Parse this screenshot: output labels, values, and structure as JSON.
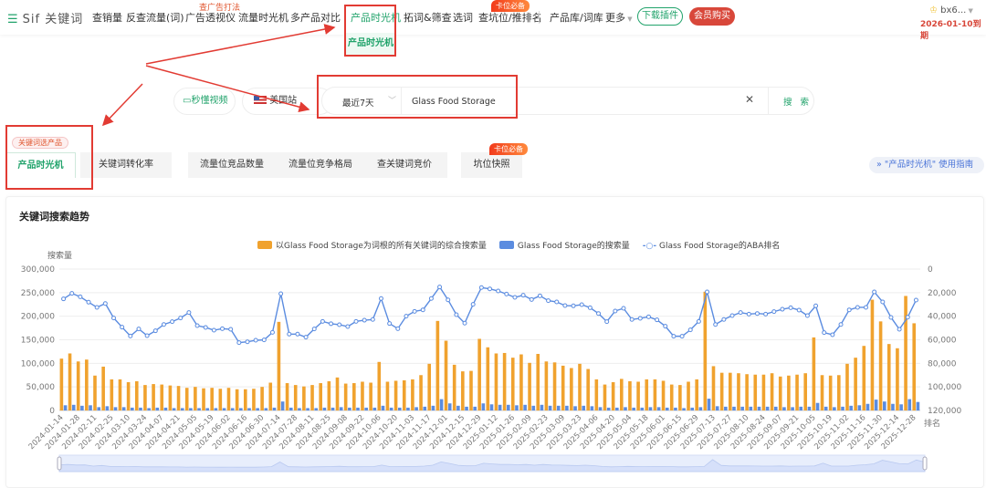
{
  "nav": {
    "logo": "Sif 关键词",
    "items": [
      "查销量",
      "反查流量(词)",
      "广告透视仪",
      "流量时光机",
      "多产品对比",
      "产品时光机",
      "拓词&筛查",
      "选词",
      "查坑位/推排名",
      "产品库/词库",
      "更多"
    ],
    "hint_ads": "查广告打法",
    "hint_rank": "卡位必备",
    "download": "下载插件",
    "vip": "会员购买",
    "user": "bx6...",
    "expire": "2026-01-10到期",
    "dropdown_item": "产品时光机"
  },
  "search": {
    "video": "秒懂视频",
    "site": "美国站",
    "range": "最近7天",
    "query": "Glass Food Storage",
    "button": "搜 索"
  },
  "tabs": {
    "badge": "关键词选产品",
    "items": [
      "产品时光机",
      "关键词转化率",
      "流量位竞品数量",
      "流量位竞争格局",
      "查关键词竞价",
      "坑位快照"
    ],
    "fire_badge": "卡位必备",
    "guide": "\"产品时光机\" 使用指南"
  },
  "colors": {
    "green": "#21a36b",
    "orange": "#f0a22e",
    "blue": "#5b8ce0",
    "red": "#e23b33"
  },
  "chart_data": {
    "type": "bar",
    "title": "关键词搜索趋势",
    "ylabel": "搜索量",
    "y2label": "排名",
    "ylim": [
      0,
      300000
    ],
    "y2lim": [
      0,
      120000
    ],
    "y2_inverted": true,
    "yticks": [
      "0",
      "50,000",
      "100,000",
      "150,000",
      "200,000",
      "250,000",
      "300,000"
    ],
    "y2ticks": [
      "0",
      "20,000",
      "40,000",
      "60,000",
      "80,000",
      "100,000",
      "120,000"
    ],
    "xtick_labels": [
      "2024-01-14",
      "2024-01-28",
      "2024-02-11",
      "2024-02-25",
      "2024-03-10",
      "2024-03-24",
      "2024-04-07",
      "2024-04-21",
      "2024-05-05",
      "2024-05-19",
      "2024-06-02",
      "2024-06-16",
      "2024-06-30",
      "2024-07-14",
      "2024-07-28",
      "2024-08-11",
      "2024-08-25",
      "2024-09-08",
      "2024-09-22",
      "2024-10-06",
      "2024-10-20",
      "2024-11-03",
      "2024-11-17",
      "2024-12-01",
      "2024-12-15",
      "2024-12-29",
      "2025-01-12",
      "2025-01-26",
      "2025-02-09",
      "2025-02-23",
      "2025-03-09",
      "2025-03-23",
      "2025-04-06",
      "2025-04-20",
      "2025-05-04",
      "2025-05-18",
      "2025-06-01",
      "2025-06-15",
      "2025-06-29",
      "2025-07-13",
      "2025-07-27",
      "2025-08-10",
      "2025-08-24",
      "2025-09-07",
      "2025-09-21",
      "2025-10-05",
      "2025-10-19",
      "2025-11-02",
      "2025-11-16",
      "2025-11-30",
      "2025-12-14",
      "2025-12-28"
    ],
    "series": [
      {
        "name": "以Glass Food Storage为词根的所有关键词的综合搜索量",
        "kind": "bar",
        "values": [
          110000,
          121000,
          104000,
          108000,
          74000,
          93000,
          66000,
          66000,
          60000,
          62000,
          54000,
          56000,
          55000,
          53000,
          52000,
          48000,
          50000,
          47000,
          48000,
          46000,
          48000,
          45000,
          45000,
          46000,
          50000,
          59000,
          188000,
          58000,
          54000,
          51000,
          54000,
          58000,
          62000,
          70000,
          57000,
          58000,
          61000,
          59000,
          103000,
          61000,
          63000,
          64000,
          66000,
          75000,
          99000,
          190000,
          148000,
          97000,
          83000,
          84000,
          152000,
          134000,
          121000,
          122000,
          112000,
          119000,
          101000,
          120000,
          104000,
          102000,
          95000,
          90000,
          99000,
          88000,
          66000,
          55000,
          60000,
          67000,
          62000,
          61000,
          66000,
          66000,
          63000,
          55000,
          54000,
          61000,
          66000,
          252000,
          94000,
          80000,
          80000,
          79000,
          77000,
          76000,
          76000,
          79000,
          72000,
          74000,
          76000,
          79000,
          155000,
          75000,
          74000,
          75000,
          99000,
          112000,
          137000,
          235000,
          189000,
          141000,
          132000,
          243000,
          185000
        ]
      },
      {
        "name": "Glass Food Storage的搜索量",
        "kind": "bar",
        "values": [
          11000,
          12000,
          10000,
          11000,
          7000,
          9000,
          7000,
          7000,
          6000,
          6000,
          5000,
          6000,
          6000,
          5000,
          5000,
          5000,
          5000,
          5000,
          5000,
          5000,
          5000,
          5000,
          5000,
          5000,
          5000,
          6000,
          19000,
          6000,
          5000,
          5000,
          5000,
          6000,
          6000,
          7000,
          6000,
          6000,
          6000,
          6000,
          10000,
          6000,
          6000,
          6000,
          7000,
          8000,
          10000,
          24000,
          15000,
          10000,
          8000,
          8000,
          15000,
          13000,
          12000,
          12000,
          11000,
          12000,
          10000,
          12000,
          10000,
          10000,
          10000,
          9000,
          10000,
          9000,
          7000,
          6000,
          6000,
          7000,
          6000,
          6000,
          7000,
          7000,
          6000,
          6000,
          5000,
          6000,
          7000,
          25000,
          9000,
          8000,
          8000,
          8000,
          8000,
          8000,
          8000,
          8000,
          7000,
          7000,
          8000,
          8000,
          16000,
          8000,
          7000,
          8000,
          10000,
          11000,
          14000,
          23000,
          19000,
          14000,
          13000,
          24000,
          18000
        ]
      },
      {
        "name": "Glass Food Storage的ABA排名",
        "kind": "line",
        "axis": "right",
        "values": [
          25300,
          20600,
          23500,
          28100,
          32500,
          29200,
          41500,
          49300,
          56800,
          50800,
          56500,
          52400,
          47000,
          44600,
          41500,
          36900,
          48000,
          49500,
          51900,
          50600,
          51100,
          62400,
          61700,
          60400,
          60100,
          53700,
          20900,
          55200,
          55200,
          57800,
          50800,
          44400,
          46400,
          47200,
          48800,
          44400,
          43400,
          42800,
          25000,
          46200,
          50600,
          40000,
          35900,
          34600,
          25000,
          15200,
          26100,
          38700,
          45900,
          29900,
          15700,
          16800,
          18600,
          21200,
          24000,
          22200,
          25800,
          22700,
          26800,
          27900,
          31000,
          31200,
          30200,
          32800,
          37700,
          44600,
          35600,
          33300,
          42800,
          41800,
          40500,
          43100,
          48500,
          57000,
          57000,
          51600,
          44400,
          19400,
          47000,
          42800,
          39500,
          36900,
          38200,
          37700,
          38200,
          36100,
          34100,
          32800,
          34800,
          39500,
          31200,
          53900,
          55700,
          47000,
          34600,
          32500,
          32500,
          19400,
          27900,
          41000,
          51100,
          40800,
          26300
        ]
      }
    ],
    "legend": "top-center",
    "grid": true
  }
}
